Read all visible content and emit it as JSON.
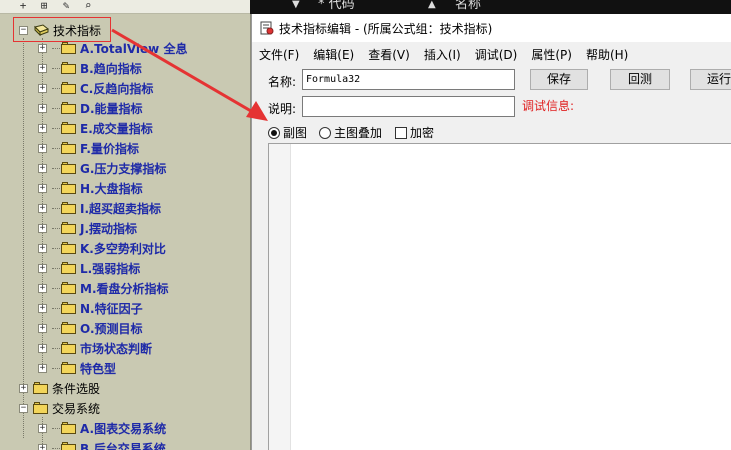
{
  "grid_header": {
    "sort_arrow": "▼",
    "col_code": "* 代码",
    "sort_arrow_2": "▲",
    "col_name": "名称"
  },
  "tree": {
    "toolbar_icons": [
      "add-icon",
      "add-child-icon",
      "edit-icon",
      "search-icon"
    ],
    "root": {
      "label": "技术指标",
      "expander": "⊟"
    },
    "items": [
      {
        "label": "A.TotalView 全息"
      },
      {
        "label": "B.趋向指标"
      },
      {
        "label": "C.反趋向指标"
      },
      {
        "label": "D.能量指标"
      },
      {
        "label": "E.成交量指标"
      },
      {
        "label": "F.量价指标"
      },
      {
        "label": "G.压力支撑指标"
      },
      {
        "label": "H.大盘指标"
      },
      {
        "label": "I.超买超卖指标"
      },
      {
        "label": "J.摆动指标"
      },
      {
        "label": "K.多空势利对比"
      },
      {
        "label": "L.强弱指标"
      },
      {
        "label": "M.看盘分析指标"
      },
      {
        "label": "N.特征因子"
      },
      {
        "label": "O.预测目标"
      },
      {
        "label": "市场状态判断"
      },
      {
        "label": "特色型"
      }
    ],
    "group_conditions": {
      "label": "条件选股"
    },
    "group_trading": {
      "label": "交易系统"
    },
    "trading_items": [
      {
        "label": "A.图表交易系统"
      },
      {
        "label": "B.后台交易系统"
      }
    ],
    "collapse_glyph": "‹"
  },
  "editor": {
    "title": "技术指标编辑 - (所属公式组：技术指标)",
    "menu": [
      "文件(F)",
      "编辑(E)",
      "查看(V)",
      "插入(I)",
      "调试(D)",
      "属性(P)",
      "帮助(H)"
    ],
    "name_label": "名称:",
    "name_value": "Formula32",
    "desc_label": "说明:",
    "desc_value": "",
    "debug_label": "调试信息:",
    "buttons": {
      "save": "保存",
      "cancel": "回测",
      "run": "运行"
    },
    "options": {
      "sub_chart": "副图",
      "main_overlay": "主图叠加",
      "encrypt": "加密"
    },
    "selected_option": "副图",
    "encrypt_checked": false
  },
  "colors": {
    "tree_bg": "#c9c9b2",
    "tree_label": "#1e2aa8",
    "highlight": "#e53333",
    "debug_text": "#e02020"
  }
}
